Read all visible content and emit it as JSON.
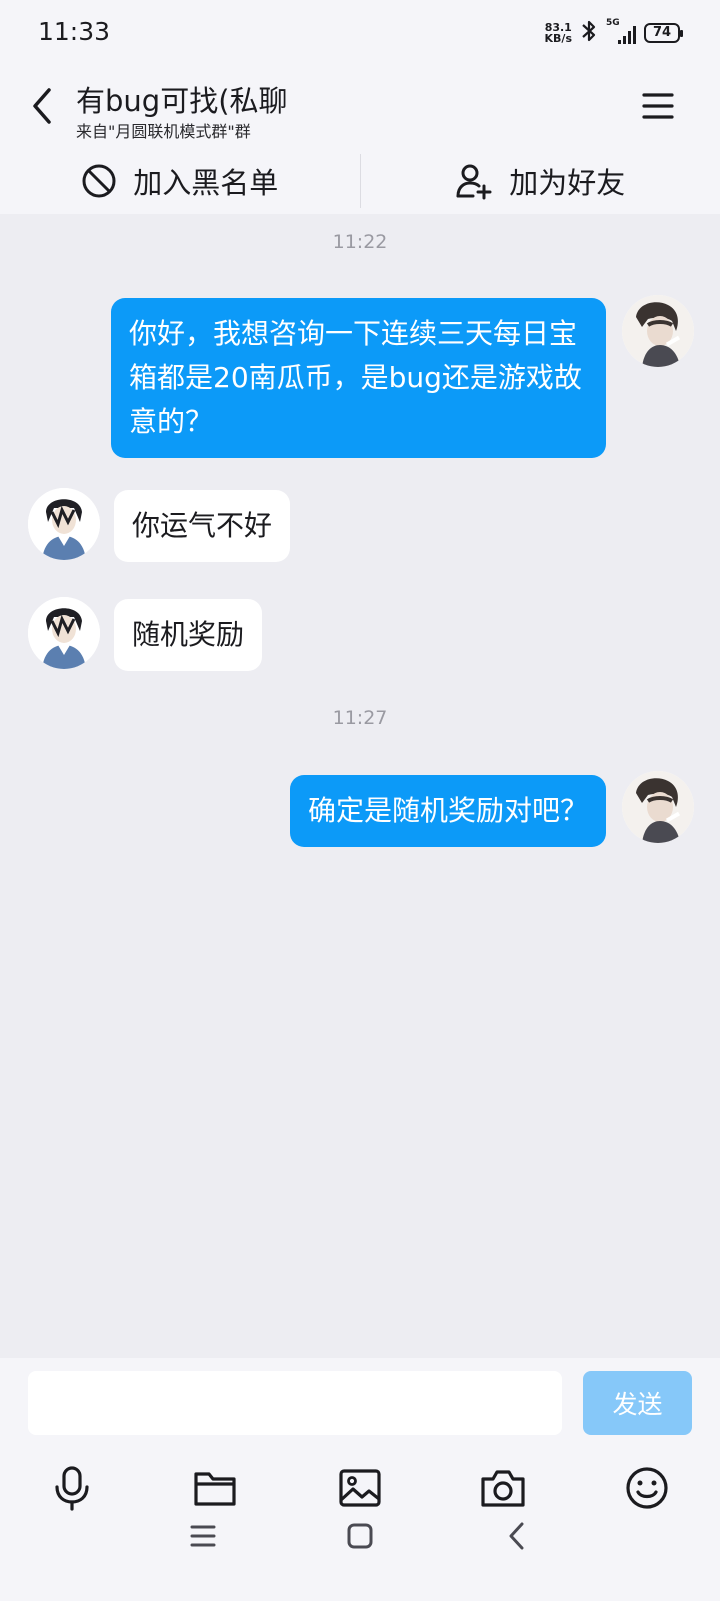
{
  "status_bar": {
    "time": "11:33",
    "net_speed_value": "83.1",
    "net_speed_unit": "KB/s",
    "network": "5G",
    "battery": "74"
  },
  "header": {
    "title": "有bug可找(私聊",
    "subtitle": "来自\"月圆联机模式群\"群"
  },
  "actions": {
    "blacklist_label": "加入黑名单",
    "add_friend_label": "加为好友"
  },
  "messages": [
    {
      "type": "time",
      "text": "11:22"
    },
    {
      "type": "out",
      "text": "你好，我想咨询一下连续三天每日宝箱都是20南瓜币，是bug还是游戏故意的？"
    },
    {
      "type": "in",
      "text": "你运气不好"
    },
    {
      "type": "in",
      "text": "随机奖励"
    },
    {
      "type": "time",
      "text": "11:27"
    },
    {
      "type": "out",
      "text": "确定是随机奖励对吧？"
    }
  ],
  "composer": {
    "input_value": "",
    "send_label": "发送"
  },
  "toolbar_icons": [
    "microphone-icon",
    "folder-icon",
    "image-icon",
    "camera-icon",
    "emoji-icon"
  ],
  "nav_icons": [
    "recent-apps-icon",
    "home-icon",
    "back-icon"
  ],
  "colors": {
    "outgoing_bubble": "#0c9af8",
    "incoming_bubble": "#ffffff",
    "send_button_disabled": "#86c8f9",
    "background": "#ededf2"
  }
}
